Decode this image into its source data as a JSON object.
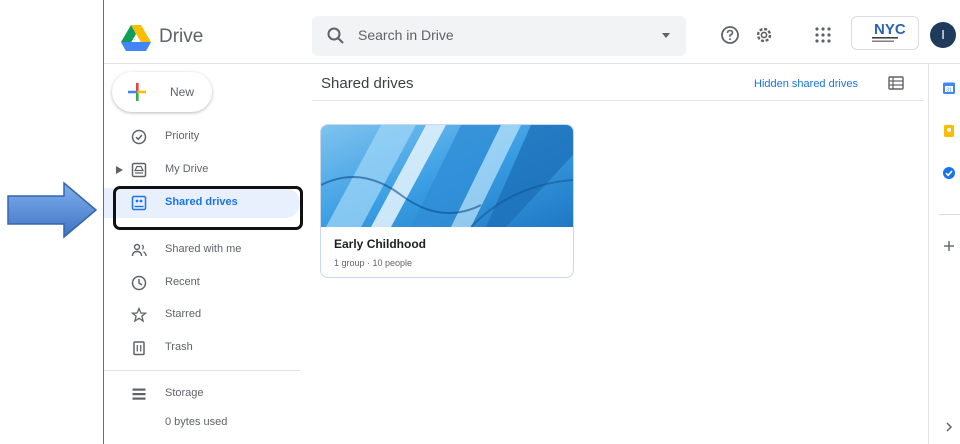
{
  "header": {
    "app_name": "Drive",
    "search_placeholder": "Search in Drive",
    "org_badge": "NYC",
    "avatar_initial": "I"
  },
  "sidebar": {
    "new_label": "New",
    "items": [
      {
        "label": "Priority",
        "icon": "priority-check-icon"
      },
      {
        "label": "My Drive",
        "icon": "my-drive-icon"
      },
      {
        "label": "Shared drives",
        "icon": "shared-drives-icon",
        "active": true
      },
      {
        "label": "Shared with me",
        "icon": "people-icon"
      },
      {
        "label": "Recent",
        "icon": "clock-icon"
      },
      {
        "label": "Starred",
        "icon": "star-icon"
      },
      {
        "label": "Trash",
        "icon": "trash-icon"
      }
    ],
    "storage_label": "Storage",
    "storage_used": "0 bytes used"
  },
  "main": {
    "title": "Shared drives",
    "hidden_link": "Hidden shared drives",
    "cards": [
      {
        "title": "Early Childhood",
        "subtitle": "1 group · 10 people"
      }
    ]
  },
  "colors": {
    "accent": "#1a73e8",
    "active_bg": "#e8f0fe",
    "annotation_arrow": "#5b8fd6"
  }
}
